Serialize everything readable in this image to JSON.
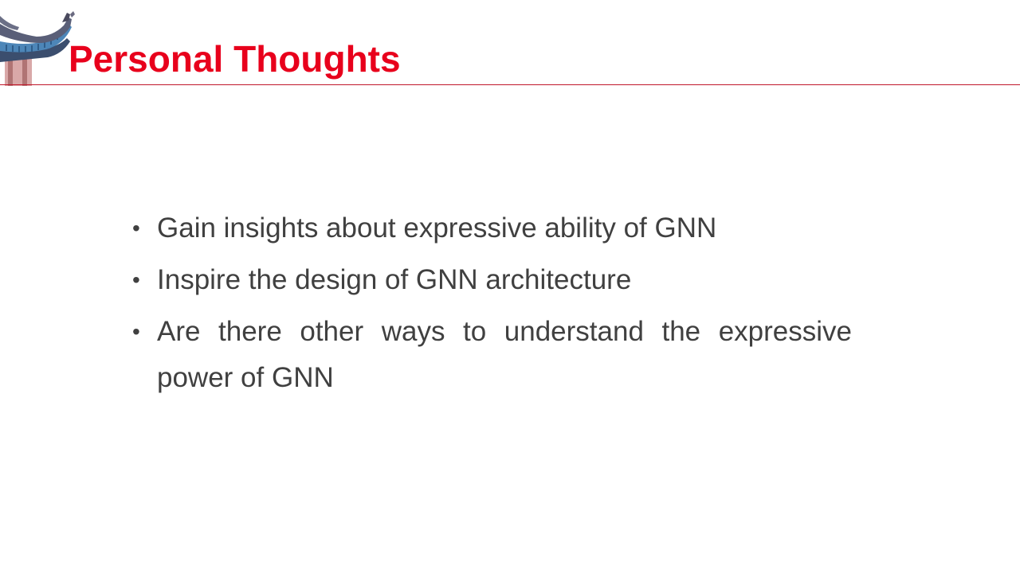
{
  "slide": {
    "title": "Personal Thoughts",
    "bullet_glyph": "•",
    "bullets": [
      {
        "text": "Gain insights about expressive ability of GNN"
      },
      {
        "text": "Inspire the design of GNN architecture"
      },
      {
        "text": "Are there other ways to understand the expressive power of GNN"
      }
    ]
  },
  "colors": {
    "title": "#e8001c",
    "rule": "#c0172a",
    "body_text": "#404040",
    "roof_tiles": "#3b4e6e",
    "roof_edge": "#4d86b8",
    "pillar": "#c98a8a"
  },
  "logo": {
    "icon": "pagoda-roof-icon"
  }
}
